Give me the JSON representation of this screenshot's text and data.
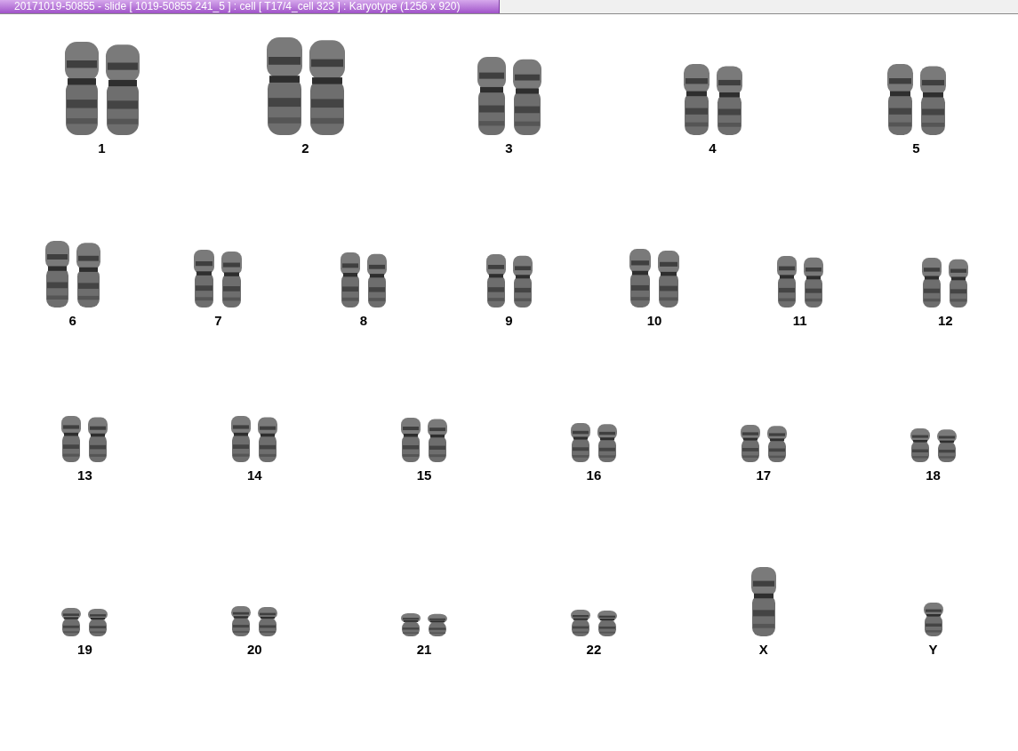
{
  "window": {
    "title": "20171019-50855 - slide [ 1019-50855 241_5 ] : cell [ T17/4_cell 323 ] : Karyotype  (1256 x 920)"
  },
  "rows": [
    {
      "items": [
        {
          "label": "1",
          "kind": "pair"
        },
        {
          "label": "2",
          "kind": "pair"
        },
        {
          "label": "3",
          "kind": "pair"
        },
        {
          "label": "4",
          "kind": "pair"
        },
        {
          "label": "5",
          "kind": "pair"
        }
      ]
    },
    {
      "items": [
        {
          "label": "6",
          "kind": "pair"
        },
        {
          "label": "7",
          "kind": "pair"
        },
        {
          "label": "8",
          "kind": "pair"
        },
        {
          "label": "9",
          "kind": "pair"
        },
        {
          "label": "10",
          "kind": "pair"
        },
        {
          "label": "11",
          "kind": "pair"
        },
        {
          "label": "12",
          "kind": "pair"
        }
      ]
    },
    {
      "items": [
        {
          "label": "13",
          "kind": "pair"
        },
        {
          "label": "14",
          "kind": "pair"
        },
        {
          "label": "15",
          "kind": "pair"
        },
        {
          "label": "16",
          "kind": "pair"
        },
        {
          "label": "17",
          "kind": "pair"
        },
        {
          "label": "18",
          "kind": "pair"
        }
      ]
    },
    {
      "items": [
        {
          "label": "19",
          "kind": "pair"
        },
        {
          "label": "20",
          "kind": "pair"
        },
        {
          "label": "21",
          "kind": "pair"
        },
        {
          "label": "22",
          "kind": "pair"
        },
        {
          "label": "X",
          "kind": "single"
        },
        {
          "label": "Y",
          "kind": "single"
        }
      ]
    }
  ]
}
